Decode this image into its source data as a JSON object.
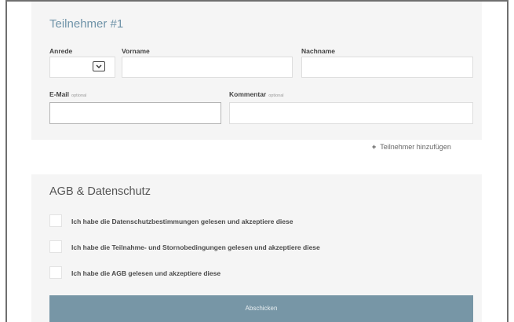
{
  "participant": {
    "title": "Teilnehmer #1",
    "salutation_label": "Anrede",
    "firstname_label": "Vorname",
    "lastname_label": "Nachname",
    "email_label": "E-Mail",
    "email_optional": "optional",
    "comment_label": "Kommentar",
    "comment_optional": "optional",
    "salutation_value": "",
    "firstname_value": "",
    "lastname_value": "",
    "email_value": "",
    "comment_value": ""
  },
  "add_participant": {
    "icon": "plus-icon",
    "label": "Teilnehmer hinzufügen"
  },
  "terms": {
    "title": "AGB & Datenschutz",
    "checkbox_privacy": "Ich habe die Datenschutzbestimmungen gelesen und akzeptiere diese",
    "checkbox_participation": "Ich habe die Teilnahme- und Stornobedingungen gelesen und akzeptiere diese",
    "checkbox_agb": "Ich habe die AGB gelesen und akzeptiere diese"
  },
  "submit_label": "Abschicken",
  "colors": {
    "accent": "#6f93a8",
    "button": "#7796a6",
    "panel": "#f5f5f5"
  }
}
